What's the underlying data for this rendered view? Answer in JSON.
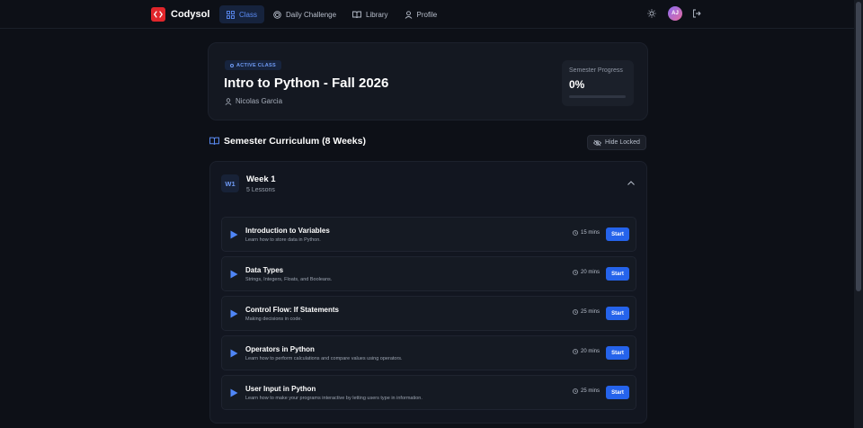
{
  "brand": {
    "name": "Codysol",
    "color": "#e0262b"
  },
  "nav": {
    "items": [
      {
        "label": "Class",
        "icon": "grid-icon",
        "active": true
      },
      {
        "label": "Daily Challenge",
        "icon": "target-icon",
        "active": false
      },
      {
        "label": "Library",
        "icon": "book-icon",
        "active": false
      },
      {
        "label": "Profile",
        "icon": "user-icon",
        "active": false
      }
    ]
  },
  "user": {
    "initials": "AJ"
  },
  "class": {
    "badge": "ACTIVE CLASS",
    "title": "Intro to Python - Fall 2026",
    "instructor": "Nicolas Garcia",
    "progress_label": "Semester Progress",
    "progress_value": "0%",
    "progress_fraction": 0
  },
  "curriculum": {
    "title": "Semester Curriculum (8 Weeks)",
    "hide_label": "Hide Locked"
  },
  "week": {
    "badge": "W1",
    "title": "Week 1",
    "subtitle": "5 Lessons",
    "lessons": [
      {
        "title": "Introduction to Variables",
        "desc": "Learn how to store data in Python.",
        "duration": "15 mins",
        "action": "Start"
      },
      {
        "title": "Data Types",
        "desc": "Strings, Integers, Floats, and Booleans.",
        "duration": "20 mins",
        "action": "Start"
      },
      {
        "title": "Control Flow: If Statements",
        "desc": "Making decisions in code.",
        "duration": "25 mins",
        "action": "Start"
      },
      {
        "title": "Operators in Python",
        "desc": "Learn how to perform calculations and compare values using operators.",
        "duration": "20 mins",
        "action": "Start"
      },
      {
        "title": "User Input in Python",
        "desc": "Learn how to make your programs interactive by letting users type in information.",
        "duration": "25 mins",
        "action": "Start"
      }
    ]
  },
  "colors": {
    "accent": "#2563eb",
    "background": "#0d1017"
  }
}
